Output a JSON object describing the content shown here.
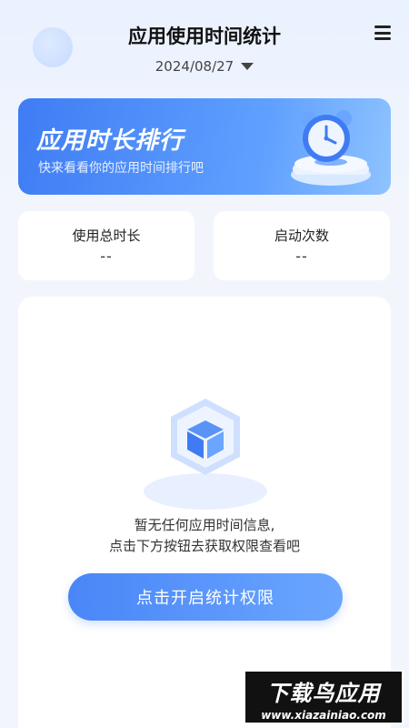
{
  "header": {
    "title": "应用使用时间统计",
    "date": "2024/08/27"
  },
  "banner": {
    "title": "应用时长排行",
    "subtitle": "快来看看你的应用时间排行吧"
  },
  "stats": {
    "total_duration": {
      "label": "使用总时长",
      "value": "--"
    },
    "launch_count": {
      "label": "启动次数",
      "value": "--"
    }
  },
  "empty_state": {
    "line1": "暂无任何应用时间信息,",
    "line2": "点击下方按钮去获取权限查看吧"
  },
  "button": {
    "label": "点击开启统计权限"
  },
  "watermark": {
    "brand": "下载鸟应用",
    "url": "www.xiazainiao.com"
  },
  "colors": {
    "accent": "#4a86f7",
    "background": "#f2f6fc"
  }
}
